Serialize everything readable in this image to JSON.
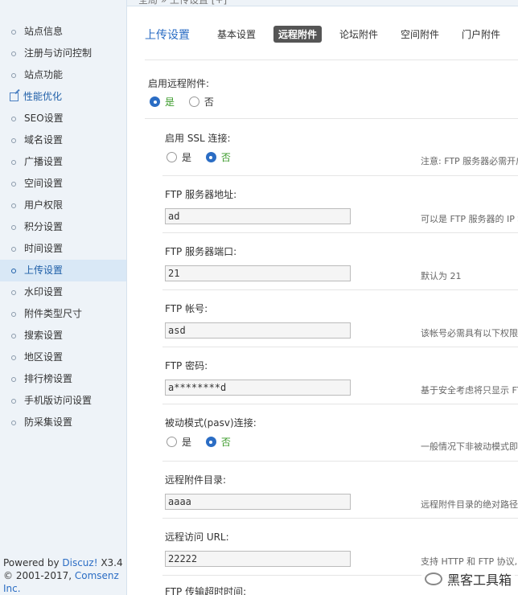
{
  "topbar": {
    "breadcrumb": "全局 » 上传设置 [+]"
  },
  "sidebar": {
    "items": [
      {
        "label": "站点信息"
      },
      {
        "label": "注册与访问控制"
      },
      {
        "label": "站点功能"
      },
      {
        "label": "性能优化"
      },
      {
        "label": "SEO设置"
      },
      {
        "label": "域名设置"
      },
      {
        "label": "广播设置"
      },
      {
        "label": "空间设置"
      },
      {
        "label": "用户权限"
      },
      {
        "label": "积分设置"
      },
      {
        "label": "时间设置"
      },
      {
        "label": "上传设置"
      },
      {
        "label": "水印设置"
      },
      {
        "label": "附件类型尺寸"
      },
      {
        "label": "搜索设置"
      },
      {
        "label": "地区设置"
      },
      {
        "label": "排行榜设置"
      },
      {
        "label": "手机版访问设置"
      },
      {
        "label": "防采集设置"
      }
    ],
    "footer": {
      "powered": "Powered by ",
      "brand": "Discuz!",
      "version": " X3.4",
      "copyright_prefix": "© 2001-2017, ",
      "company": "Comsenz Inc."
    }
  },
  "main": {
    "page_title": "上传设置",
    "tabs": [
      {
        "label": "基本设置"
      },
      {
        "label": "远程附件"
      },
      {
        "label": "论坛附件"
      },
      {
        "label": "空间附件"
      },
      {
        "label": "门户附件"
      }
    ]
  },
  "form": {
    "enable_remote": {
      "label": "启用远程附件:",
      "yes": "是",
      "no": "否"
    },
    "ssl": {
      "label": "启用 SSL 连接:",
      "yes": "是",
      "no": "否",
      "note": "注意: FTP 服务器必需开启"
    },
    "ftp_host": {
      "label": "FTP 服务器地址:",
      "value": "ad",
      "note": "可以是 FTP 服务器的 IP 地"
    },
    "ftp_port": {
      "label": "FTP 服务器端口:",
      "value": "21",
      "note": "默认为 21"
    },
    "ftp_user": {
      "label": "FTP 帐号:",
      "value": "asd",
      "note": "该帐号必需具有以下权限:"
    },
    "ftp_pass": {
      "label": "FTP 密码:",
      "value": "a********d",
      "note": "基于安全考虑将只显示 FTP"
    },
    "pasv": {
      "label": "被动模式(pasv)连接:",
      "yes": "是",
      "no": "否",
      "note": "一般情况下非被动模式即可"
    },
    "remote_dir": {
      "label": "远程附件目录:",
      "value": "aaaa",
      "note": "远程附件目录的绝对路径或"
    },
    "remote_url": {
      "label": "远程访问 URL:",
      "value": "22222",
      "note": "支持 HTTP 和 FTP 协议, 结"
    },
    "ftp_timeout": {
      "label": "FTP 传输超时时间:"
    }
  },
  "watermark": {
    "text": "黑客工具箱"
  }
}
